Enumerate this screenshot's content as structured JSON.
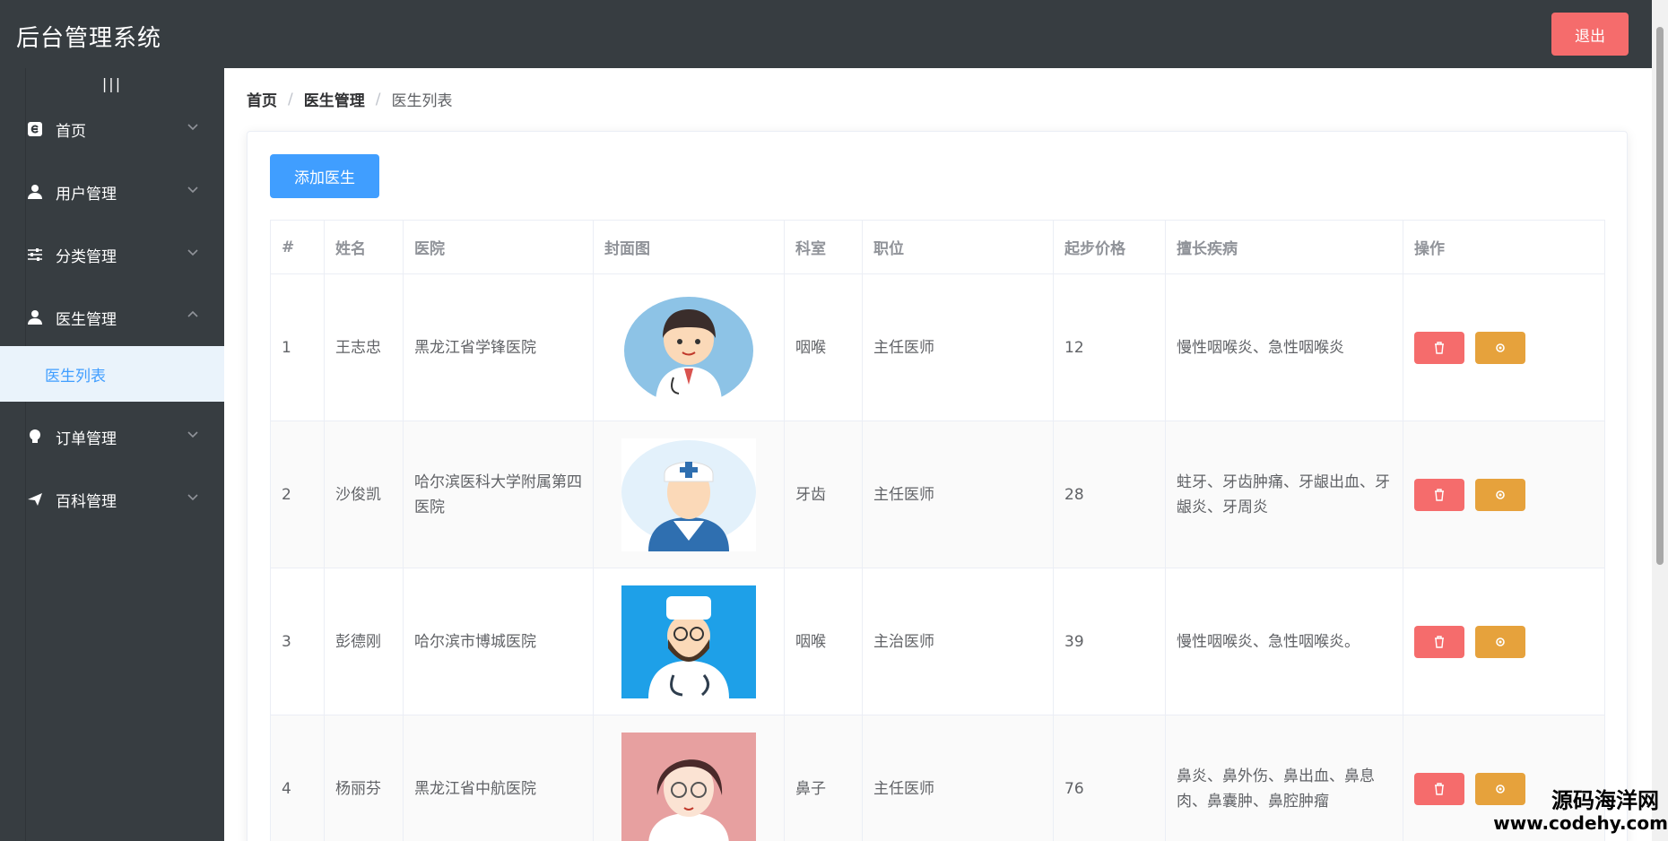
{
  "header": {
    "title": "后台管理系统",
    "logout_label": "退出"
  },
  "sidebar": {
    "collapse_label": "|||",
    "items": [
      {
        "label": "首页",
        "icon": "home-icon"
      },
      {
        "label": "用户管理",
        "icon": "user-icon"
      },
      {
        "label": "分类管理",
        "icon": "sliders-icon"
      },
      {
        "label": "医生管理",
        "icon": "doctor-icon",
        "expanded": true
      },
      {
        "label": "订单管理",
        "icon": "bulb-icon"
      },
      {
        "label": "百科管理",
        "icon": "send-icon"
      }
    ],
    "active_sub": {
      "label": "医生列表"
    }
  },
  "breadcrumb": {
    "home": "首页",
    "section": "医生管理",
    "current": "医生列表"
  },
  "actions": {
    "add_label": "添加医生"
  },
  "table": {
    "headers": [
      "#",
      "姓名",
      "医院",
      "封面图",
      "科室",
      "职位",
      "起步价格",
      "擅长疾病",
      "操作"
    ],
    "rows": [
      {
        "index": "1",
        "name": "王志忠",
        "hospital": "黑龙江省学锋医院",
        "dept": "咽喉",
        "title": "主任医师",
        "price": "12",
        "specialty": "慢性咽喉炎、急性咽喉炎"
      },
      {
        "index": "2",
        "name": "沙俊凯",
        "hospital": "哈尔滨医科大学附属第四医院",
        "dept": "牙齿",
        "title": "主任医师",
        "price": "28",
        "specialty": "蛀牙、牙齿肿痛、牙龈出血、牙龈炎、牙周炎"
      },
      {
        "index": "3",
        "name": "彭德刚",
        "hospital": "哈尔滨市博城医院",
        "dept": "咽喉",
        "title": "主治医师",
        "price": "39",
        "specialty": "慢性咽喉炎、急性咽喉炎。"
      },
      {
        "index": "4",
        "name": "杨丽芬",
        "hospital": "黑龙江省中航医院",
        "dept": "鼻子",
        "title": "主任医师",
        "price": "76",
        "specialty": "鼻炎、鼻外伤、鼻出血、鼻息肉、鼻囊肿、鼻腔肿瘤"
      }
    ]
  },
  "watermark": {
    "line1": "源码海洋网",
    "line2": "www.codehy.com"
  },
  "colors": {
    "header_bg": "#373d41",
    "accent": "#409eff",
    "danger": "#f56c6c",
    "warning": "#e6a23c"
  }
}
